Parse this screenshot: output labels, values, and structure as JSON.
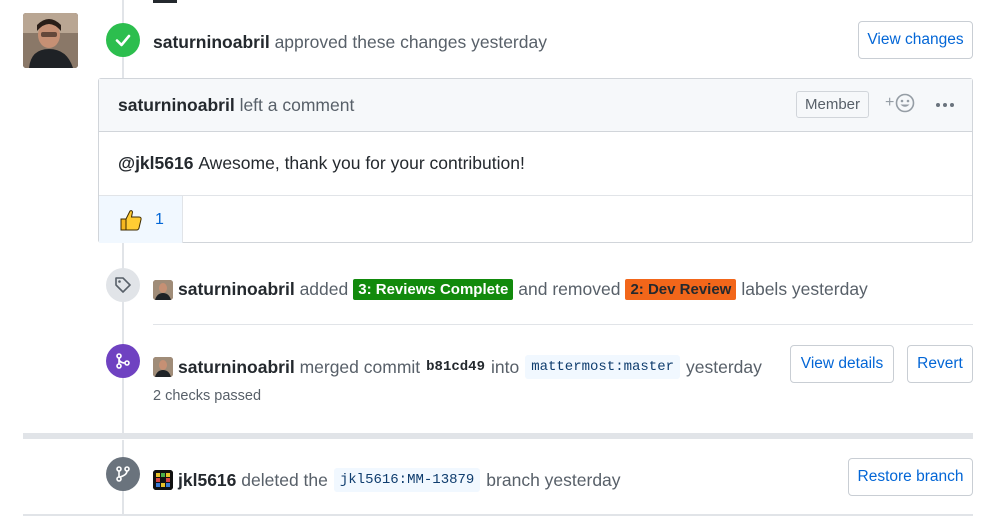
{
  "approval": {
    "author": "saturninoabril",
    "text": "approved these changes yesterday",
    "view_changes_label": "View changes"
  },
  "comment": {
    "author": "saturninoabril",
    "action": "left a comment",
    "member_label": "Member",
    "add_reaction": "+",
    "mention": "@jkl5616",
    "body": "Awesome, thank you for your contribution!",
    "reaction_count": "1"
  },
  "labels_event": {
    "author": "saturninoabril",
    "added_text": "added",
    "added_label": "3: Reviews Complete",
    "removed_text": "and removed",
    "removed_label": "2: Dev Review",
    "suffix": "labels yesterday"
  },
  "merge_event": {
    "author": "saturninoabril",
    "text": "merged commit",
    "sha": "b81cd49",
    "into": "into",
    "target": "mattermost:master",
    "time": "yesterday",
    "checks": "2 checks passed",
    "view_details_label": "View details",
    "revert_label": "Revert"
  },
  "delete_event": {
    "author": "jkl5616",
    "text": "deleted the",
    "branch": "jkl5616:MM-13879",
    "suffix": "branch yesterday",
    "restore_label": "Restore branch"
  },
  "colors": {
    "approve_green": "#2cbe4e",
    "label_green": "#128a0c",
    "label_orange": "#f2661a",
    "merged_purple": "#6f42c1",
    "link_blue": "#0366d6",
    "gray_badge": "#6a737d"
  }
}
